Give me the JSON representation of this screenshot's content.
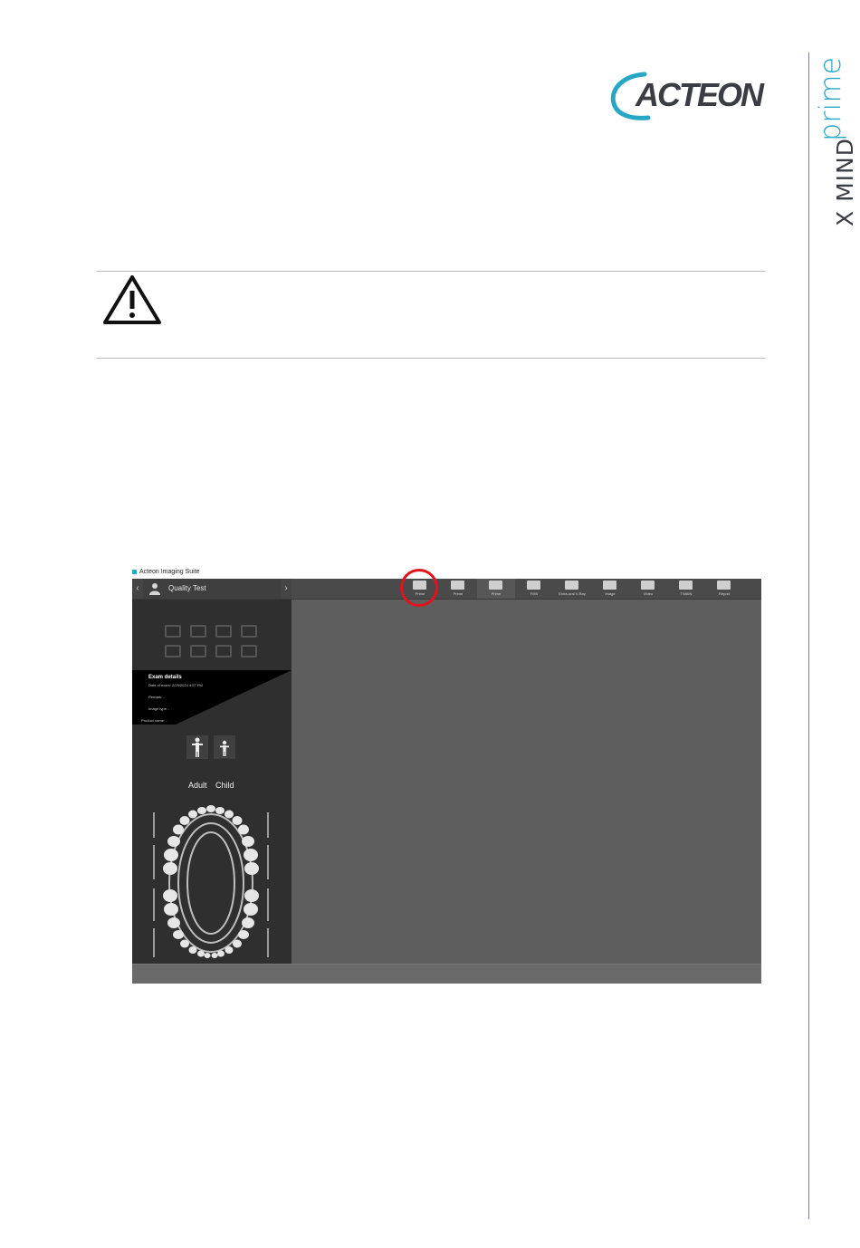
{
  "brand": {
    "logo_text": "ACTEON",
    "side_product": "X MIND",
    "side_product_suffix": "prime"
  },
  "colors": {
    "accent": "#27a7c6",
    "logo_gray": "#3a3d44",
    "callout_red": "#e1141d"
  },
  "warning": {
    "icon": "warning-triangle-icon"
  },
  "screenshot": {
    "window_title": "Acteon Imaging Suite",
    "patient_name": "Quality Test",
    "toolbar": [
      {
        "label": "Prime",
        "icon": "intraoral-sensor-icon",
        "active": false
      },
      {
        "label": "Prime",
        "icon": "panoramic-icon",
        "active": false
      },
      {
        "label": "Prime",
        "icon": "cephalometric-icon",
        "active": true
      },
      {
        "label": "FMS",
        "icon": "full-mouth-series-icon",
        "active": false
      },
      {
        "label": "Extra-oral X-Ray",
        "icon": "extraoral-xray-icon",
        "active": false
      },
      {
        "label": "Image",
        "icon": "camera-icon",
        "active": false
      },
      {
        "label": "Video",
        "icon": "video-icon",
        "active": false
      },
      {
        "label": "TWAIN",
        "icon": "twain-icon",
        "active": false
      },
      {
        "label": "Report",
        "icon": "report-icon",
        "active": false
      }
    ],
    "exam": {
      "title": "Exam details",
      "date_label": "Date of exam:",
      "date_value": "2/29/2024 4:57 PM",
      "remark_label": "Remark:",
      "remark_value": "-",
      "image_type_label": "Image type:",
      "image_type_value": "-",
      "product_label": "Product name:",
      "product_value": "-"
    },
    "age": {
      "adult": "Adult",
      "child": "Child"
    }
  }
}
